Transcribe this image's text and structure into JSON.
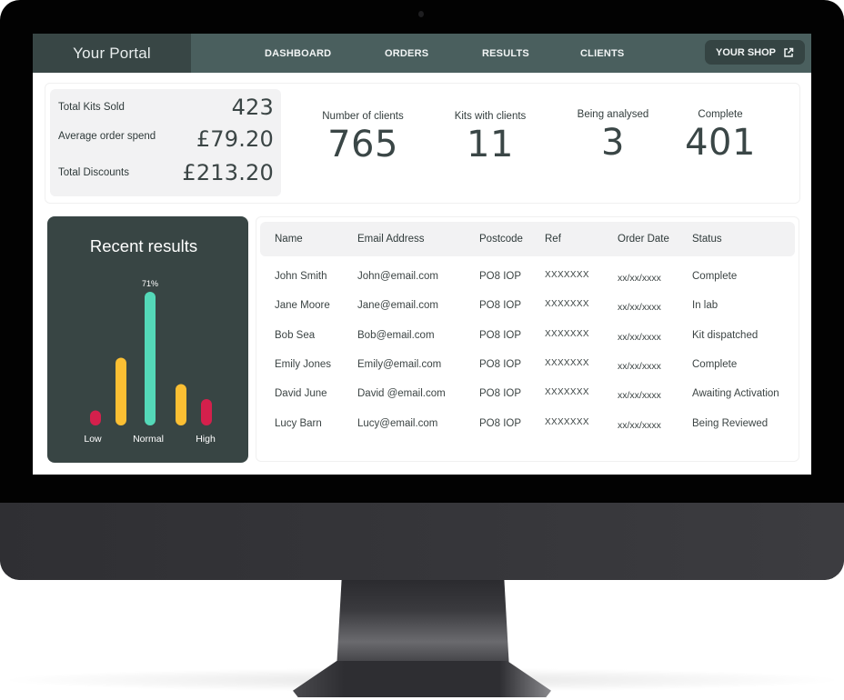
{
  "header": {
    "brand": "Your Portal",
    "nav": [
      {
        "label": "DASHBOARD"
      },
      {
        "label": "ORDERS"
      },
      {
        "label": "RESULTS"
      },
      {
        "label": "CLIENTS"
      }
    ],
    "shop_button": {
      "label": "YOUR SHOP",
      "icon": "external-link-icon"
    }
  },
  "summary": [
    {
      "label": "Total Kits Sold",
      "value": "423"
    },
    {
      "label": "Average order spend",
      "value": "£79.20"
    },
    {
      "label": "Total Discounts",
      "value": "£213.20"
    }
  ],
  "kpis": [
    {
      "label": "Number of clients",
      "value": "765"
    },
    {
      "label": "Kits with clients",
      "value": "11"
    },
    {
      "label": "Being analysed",
      "value": "3"
    },
    {
      "label": "Complete",
      "value": "401"
    }
  ],
  "recent_results": {
    "title": "Recent results",
    "chart_data": {
      "type": "bar",
      "title": "Recent results",
      "categories": [
        "Low",
        "",
        "Normal",
        "",
        "High"
      ],
      "tick_labels": [
        "Low",
        "Normal",
        "High"
      ],
      "values": [
        8,
        36,
        71,
        22,
        14
      ],
      "value_unit": "%",
      "data_labels": [
        null,
        null,
        "71%",
        null,
        null
      ],
      "colors": [
        "#d4204c",
        "#fbbf33",
        "#54d8b8",
        "#fbbf33",
        "#d4204c"
      ],
      "ylim": [
        0,
        100
      ],
      "grid": false,
      "legend": "none"
    }
  },
  "table": {
    "columns": [
      "Name",
      "Email Address",
      "Postcode",
      "Ref",
      "Order Date",
      "Status"
    ],
    "rows": [
      [
        "John Smith",
        "John@email.com",
        "PO8 IOP",
        "XXXXXXX",
        "xx/xx/xxxx",
        "Complete"
      ],
      [
        "Jane Moore",
        "Jane@email.com",
        "PO8 IOP",
        "XXXXXXX",
        "xx/xx/xxxx",
        "In lab"
      ],
      [
        "Bob Sea",
        "Bob@email.com",
        "PO8 IOP",
        "XXXXXXX",
        "xx/xx/xxxx",
        "Kit dispatched"
      ],
      [
        "Emily Jones",
        "Emily@email.com",
        "PO8 IOP",
        "XXXXXXX",
        "xx/xx/xxxx",
        "Complete"
      ],
      [
        "David June",
        "David @email.com",
        "PO8 IOP",
        "XXXXXXX",
        "xx/xx/xxxx",
        "Awaiting Activation"
      ],
      [
        "Lucy Barn",
        "Lucy@email.com",
        "PO8 IOP",
        "XXXXXXX",
        "xx/xx/xxxx",
        "Being Reviewed"
      ]
    ]
  },
  "colors": {
    "nav_bg": "#4a5f5e",
    "brand_bg": "#384645",
    "card_dark": "#384544",
    "low_high": "#d4204c",
    "borderline": "#fbbf33",
    "normal": "#54d8b8"
  }
}
